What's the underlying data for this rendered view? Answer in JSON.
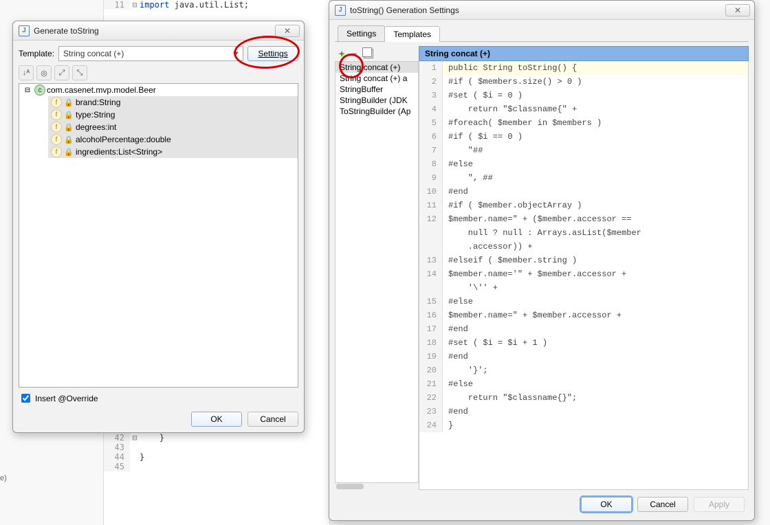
{
  "background": {
    "line11_num": "11",
    "line11_code": "import java.util.List;",
    "lines_tail": [
      "42",
      "43",
      "44",
      "45"
    ],
    "tail_code": [
      "    }",
      "",
      "}",
      ""
    ]
  },
  "sidebar_stub": "e)",
  "generate": {
    "title": "Generate toString",
    "template_label": "Template:",
    "template_value": "String concat (+)",
    "settings_btn": "Settings",
    "tree_root": "com.casenet.mvp.model.Beer",
    "fields": [
      "brand:String",
      "type:String",
      "degrees:int",
      "alcoholPercentage:double",
      "ingredients:List<String>"
    ],
    "insert_override": "Insert @Override",
    "ok": "OK",
    "cancel": "Cancel"
  },
  "settings": {
    "title": "toString() Generation Settings",
    "tabs": [
      "Settings",
      "Templates"
    ],
    "active_tab": 1,
    "templates": [
      "String concat (+)",
      "String concat (+) a",
      "StringBuffer",
      "StringBuilder (JDK",
      "ToStringBuilder (Ap"
    ],
    "selected_template": 0,
    "editor_title": "String concat (+)",
    "code_lines": [
      "public String toString() {",
      "#if ( $members.size() > 0 )",
      "#set ( $i = 0 )",
      "    return \"$classname{\" +",
      "#foreach( $member in $members )",
      "#if ( $i == 0 )",
      "    \"##",
      "#else",
      "    \", ##",
      "#end",
      "#if ( $member.objectArray )",
      "$member.name=\" + ($member.accessor == ",
      "    null ? null : Arrays.asList($member",
      "    .accessor)) +",
      "#elseif ( $member.string )",
      "$member.name='\" + $member.accessor + ",
      "    '\\'' +",
      "#else",
      "$member.name=\" + $member.accessor +",
      "#end",
      "#set ( $i = $i + 1 )",
      "#end",
      "    '}';",
      "#else",
      "    return \"$classname{}\";",
      "#end",
      "}"
    ],
    "line_numbers": [
      "1",
      "2",
      "3",
      "4",
      "5",
      "6",
      "7",
      "8",
      "9",
      "10",
      "11",
      "12",
      "",
      "",
      "13",
      "14",
      "",
      "15",
      "16",
      "17",
      "18",
      "19",
      "20",
      "21",
      "22",
      "23",
      "24"
    ],
    "ok": "OK",
    "cancel": "Cancel",
    "apply": "Apply"
  }
}
